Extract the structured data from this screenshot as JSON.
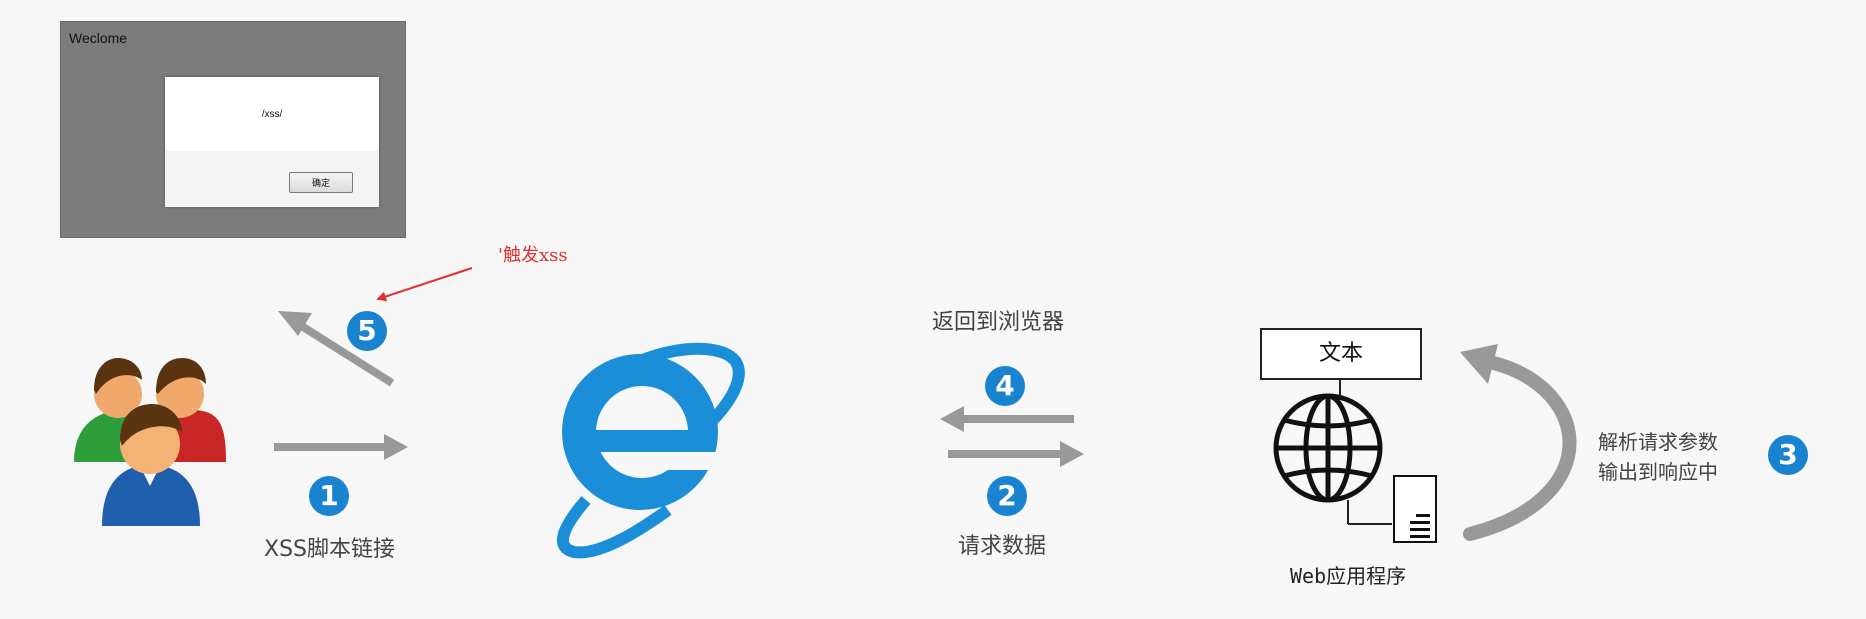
{
  "popup": {
    "window_title": "Weclome",
    "message": "/xss/",
    "ok_label": "确定"
  },
  "annotation": {
    "trigger_note": "'触发xss"
  },
  "steps": {
    "step1": {
      "number": "1",
      "label": "XSS脚本链接"
    },
    "step2": {
      "number": "2",
      "label": "请求数据"
    },
    "step3": {
      "number": "3",
      "label_line1": "解析请求参数",
      "label_line2": "输出到响应中"
    },
    "step4": {
      "number": "4",
      "label": "返回到浏览器"
    },
    "step5": {
      "number": "5"
    }
  },
  "server": {
    "box_text": "文本",
    "label": "Web应用程序"
  },
  "colors": {
    "badge": "#1a83d0",
    "arrow": "#999999",
    "annotation": "#e03030",
    "ie_blue": "#1a8fd8"
  },
  "icons": {
    "users": "users-group-icon",
    "browser": "internet-explorer-icon",
    "globe": "globe-icon",
    "server": "server-icon"
  }
}
